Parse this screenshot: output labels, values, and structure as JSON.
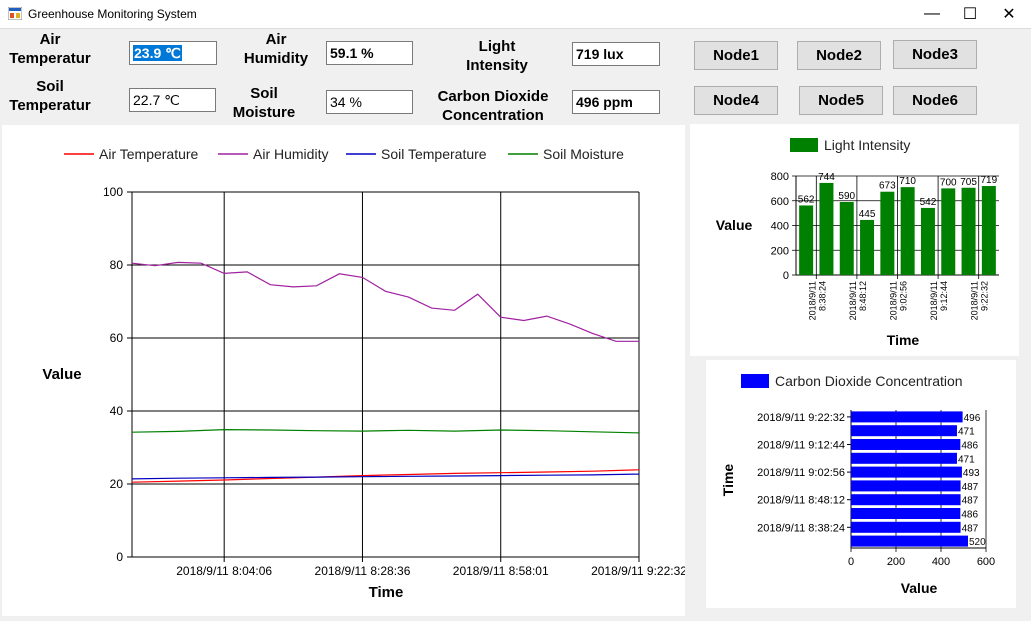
{
  "window": {
    "title": "Greenhouse Monitoring System",
    "minimize": "—",
    "maximize": "☐",
    "close": "✕"
  },
  "readings": {
    "air_temp_label": [
      "Air",
      "Temperatur"
    ],
    "air_temp_value": "23.9 ℃",
    "air_humidity_label": [
      "Air",
      "Humidity"
    ],
    "air_humidity_value": "59.1 %",
    "light_label": [
      "Light",
      "Intensity"
    ],
    "light_value": "719 lux",
    "soil_temp_label": [
      "Soil",
      "Temperatur"
    ],
    "soil_temp_value": "22.7 ℃",
    "soil_moisture_label": [
      "Soil",
      "Moisture"
    ],
    "soil_moisture_value": "34 %",
    "co2_label": [
      "Carbon Dioxide",
      "Concentration"
    ],
    "co2_value": "496 ppm"
  },
  "nodes": [
    "Node1",
    "Node2",
    "Node3",
    "Node4",
    "Node5",
    "Node6"
  ],
  "chart_data": [
    {
      "type": "line",
      "xlabel": "Time",
      "ylabel": "Value",
      "ylim": [
        0,
        100
      ],
      "yticks": [
        0,
        20,
        40,
        60,
        80,
        100
      ],
      "xlim": [
        0,
        11
      ],
      "xticks": [
        {
          "x": 2,
          "label": "2018/9/11 8:04:06"
        },
        {
          "x": 5,
          "label": "2018/9/11 8:28:36"
        },
        {
          "x": 8,
          "label": "2018/9/11 8:58:01"
        },
        {
          "x": 11,
          "label": "2018/9/11 9:22:32"
        }
      ],
      "grid": true,
      "legend": "top",
      "series": [
        {
          "name": "Air Temperature",
          "color": "#ff0000",
          "x": [
            0,
            1,
            2,
            3,
            4,
            5,
            6,
            7,
            8,
            9,
            10,
            11
          ],
          "values": [
            20.5,
            20.8,
            21.1,
            21.5,
            21.9,
            22.3,
            22.6,
            22.9,
            23.1,
            23.3,
            23.5,
            23.9
          ]
        },
        {
          "name": "Air Humidity",
          "color": "#a020a0",
          "x": [
            0,
            0.5,
            1,
            1.5,
            2,
            2.5,
            3,
            3.5,
            4,
            4.5,
            5,
            5.5,
            6,
            6.5,
            7,
            7.5,
            8,
            8.5,
            9,
            9.5,
            10,
            10.5,
            11
          ],
          "values": [
            80.5,
            79.8,
            80.7,
            80.5,
            77.7,
            78.1,
            74.6,
            74.0,
            74.3,
            77.6,
            76.6,
            72.8,
            71.2,
            68.2,
            67.6,
            72.0,
            65.7,
            64.8,
            66.0,
            63.8,
            61.2,
            59.1,
            59.1
          ]
        },
        {
          "name": "Soil Temperature",
          "color": "#0000c0",
          "x": [
            0,
            1,
            2,
            3,
            4,
            5,
            6,
            7,
            8,
            9,
            10,
            11
          ],
          "values": [
            21.4,
            21.6,
            21.7,
            21.8,
            21.9,
            22.0,
            22.1,
            22.2,
            22.3,
            22.4,
            22.5,
            22.7
          ]
        },
        {
          "name": "Soil Moisture",
          "color": "#008000",
          "x": [
            0,
            1,
            2,
            3,
            4,
            5,
            6,
            7,
            8,
            9,
            10,
            11
          ],
          "values": [
            34.2,
            34.4,
            34.9,
            34.8,
            34.6,
            34.5,
            34.7,
            34.5,
            34.8,
            34.6,
            34.3,
            34.0
          ]
        }
      ]
    },
    {
      "type": "bar",
      "xlabel": "Time",
      "ylabel": "Value",
      "ylim": [
        0,
        800
      ],
      "yticks": [
        0,
        200,
        400,
        600,
        800
      ],
      "legend": "top",
      "series": [
        {
          "name": "Light Intensity",
          "color": "#008000"
        }
      ],
      "values": [
        562,
        744,
        590,
        445,
        673,
        710,
        542,
        700,
        705,
        719
      ],
      "labeled_ticks": [
        {
          "index": 1,
          "label": [
            "2018/9/11",
            "8:38:24"
          ]
        },
        {
          "index": 3,
          "label": [
            "2018/9/11",
            "8:48:12"
          ]
        },
        {
          "index": 5,
          "label": [
            "2018/9/11",
            "9:02:56"
          ]
        },
        {
          "index": 7,
          "label": [
            "2018/9/11",
            "9:12:44"
          ]
        },
        {
          "index": 9,
          "label": [
            "2018/9/11",
            "9:22:32"
          ]
        }
      ]
    },
    {
      "type": "bar",
      "orientation": "horizontal",
      "xlabel": "Value",
      "ylabel": "Time",
      "xlim": [
        0,
        600
      ],
      "xticks": [
        0,
        200,
        400,
        600
      ],
      "legend": "top",
      "series": [
        {
          "name": "Carbon Dioxide Concentration",
          "color": "#0000ff"
        }
      ],
      "values": [
        520,
        487,
        486,
        487,
        487,
        493,
        471,
        486,
        471,
        496
      ],
      "value_labels": [
        "520",
        "487",
        "486",
        "487",
        "487",
        "493",
        "471",
        "486",
        "471",
        "496"
      ],
      "category_labels": [
        {
          "index": 1,
          "label": "2018/9/11 8:38:24"
        },
        {
          "index": 3,
          "label": "2018/9/11 8:48:12"
        },
        {
          "index": 5,
          "label": "2018/9/11 9:02:56"
        },
        {
          "index": 7,
          "label": "2018/9/11 9:12:44"
        },
        {
          "index": 9,
          "label": "2018/9/11 9:22:32"
        }
      ]
    }
  ]
}
